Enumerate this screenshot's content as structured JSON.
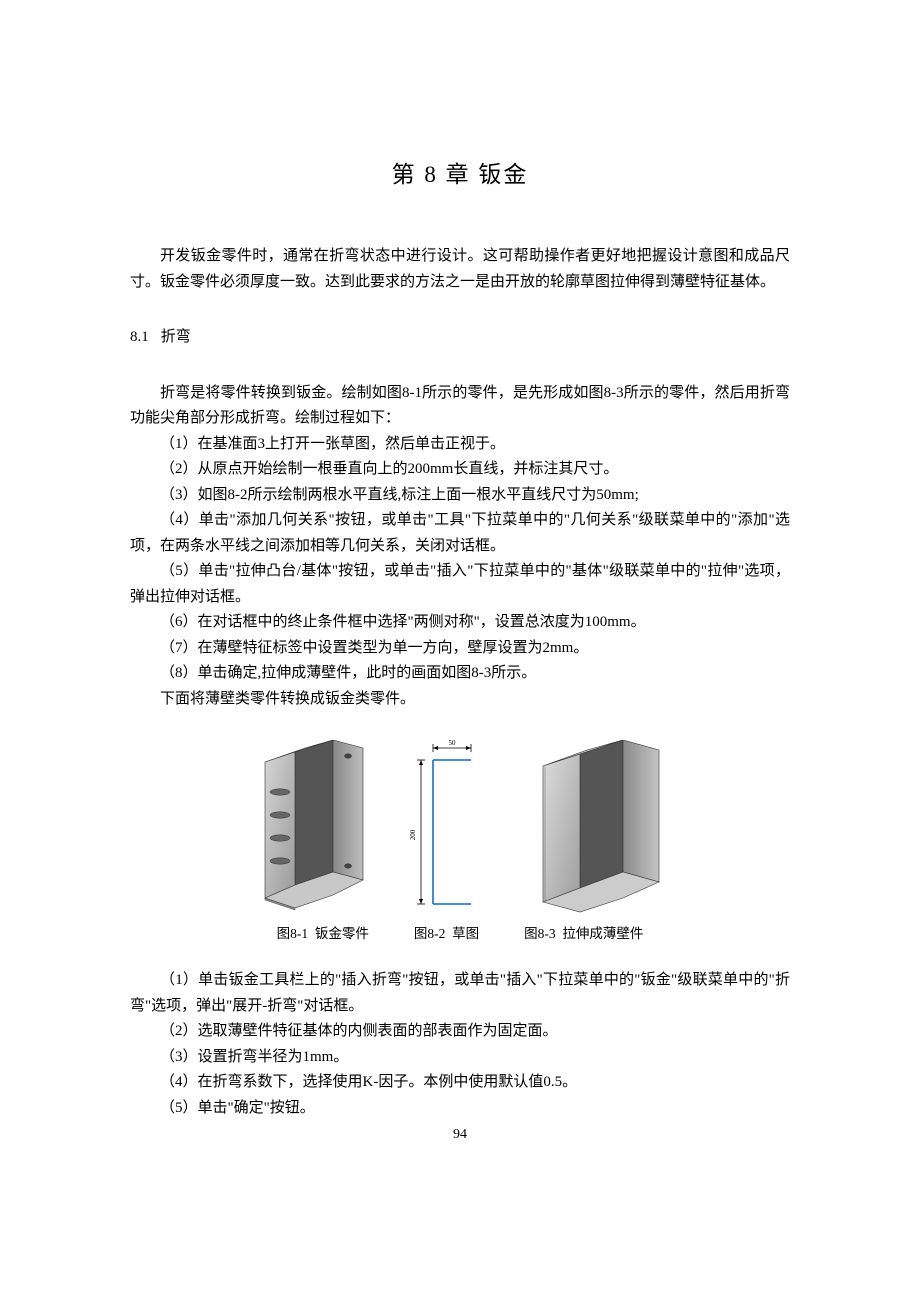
{
  "chapter": {
    "title": "第 8 章   钣金"
  },
  "intro": "开发钣金零件时，通常在折弯状态中进行设计。这可帮助操作者更好地把握设计意图和成品尺寸。钣金零件必须厚度一致。达到此要求的方法之一是由开放的轮廓草图拉伸得到薄壁特征基体。",
  "section81": {
    "number": "8.1",
    "title": "折弯",
    "lead": "折弯是将零件转换到钣金。绘制如图8-1所示的零件，是先形成如图8-3所示的零件，然后用折弯功能尖角部分形成折弯。绘制过程如下：",
    "steps_a": [
      "（1）在基准面3上打开一张草图，然后单击正视于。",
      "（2）从原点开始绘制一根垂直向上的200mm长直线，并标注其尺寸。",
      "（3）如图8-2所示绘制两根水平直线,标注上面一根水平直线尺寸为50mm;",
      "（4）单击\"添加几何关系\"按钮，或单击\"工具\"下拉菜单中的\"几何关系\"级联菜单中的\"添加\"选项，在两条水平线之间添加相等几何关系，关闭对话框。",
      "（5）单击\"拉伸凸台/基体\"按钮，或单击\"插入\"下拉菜单中的\"基体\"级联菜单中的\"拉伸\"选项，弹出拉伸对话框。",
      "（6）在对话框中的终止条件框中选择\"两侧对称\"，设置总浓度为100mm。",
      "（7）在薄壁特征标签中设置类型为单一方向，壁厚设置为2mm。",
      "（8）单击确定,拉伸成薄壁件，此时的画面如图8-3所示。"
    ],
    "after_steps_a": "下面将薄壁类零件转换成钣金类零件。",
    "steps_b": [
      "（1）单击钣金工具栏上的\"插入折弯\"按钮，或单击\"插入\"下拉菜单中的\"钣金\"级联菜单中的\"折弯\"选项，弹出\"展开-折弯\"对话框。",
      "（2）选取薄壁件特征基体的内侧表面的部表面作为固定面。",
      "（3）设置折弯半径为1mm。",
      "（4）在折弯系数下，选择使用K-因子。本例中使用默认值0.5。",
      "（5）单击\"确定\"按钮。"
    ]
  },
  "figures": {
    "fig81": {
      "label": "图8-1",
      "caption": "钣金零件"
    },
    "fig82": {
      "label": "图8-2",
      "caption": "草图",
      "dim_top": "50",
      "dim_side": "200"
    },
    "fig83": {
      "label": "图8-3",
      "caption": "拉伸成薄壁件"
    }
  },
  "page_number": "94"
}
